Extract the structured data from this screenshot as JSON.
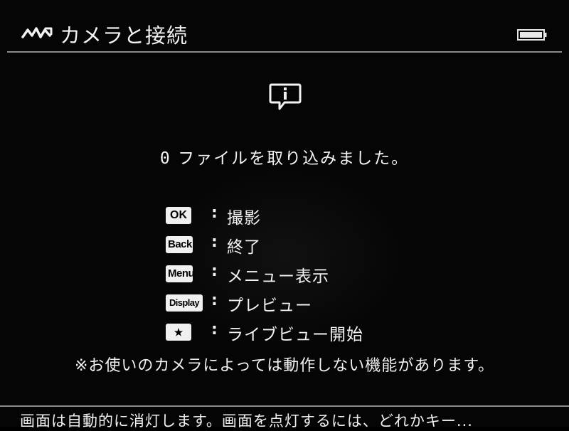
{
  "header": {
    "app_icon": "connection-wave-icon",
    "title": "カメラと接続",
    "battery_icon": "battery-full-icon"
  },
  "main": {
    "info_icon": "info-speech-bubble-icon",
    "file_count": "0",
    "message": "ファイルを取り込みました。",
    "separator": ":",
    "shortcuts": [
      {
        "key": "OK",
        "action": "撮影"
      },
      {
        "key": "Back",
        "action": "終了"
      },
      {
        "key": "Menu",
        "action": "メニュー表示"
      },
      {
        "key": "Display",
        "action": "プレビュー"
      },
      {
        "key": "★",
        "action": "ライブビュー開始"
      }
    ],
    "note": "※お使いのカメラによっては動作しない機能があります。"
  },
  "status_bar": {
    "text": "画面は自動的に消灯します。画面を点灯するには、どれかキー..."
  },
  "colors": {
    "background": "#000000",
    "text": "#f2f2f2",
    "badge_bg": "#f0f0f0",
    "rule": "#8a8a8a"
  }
}
